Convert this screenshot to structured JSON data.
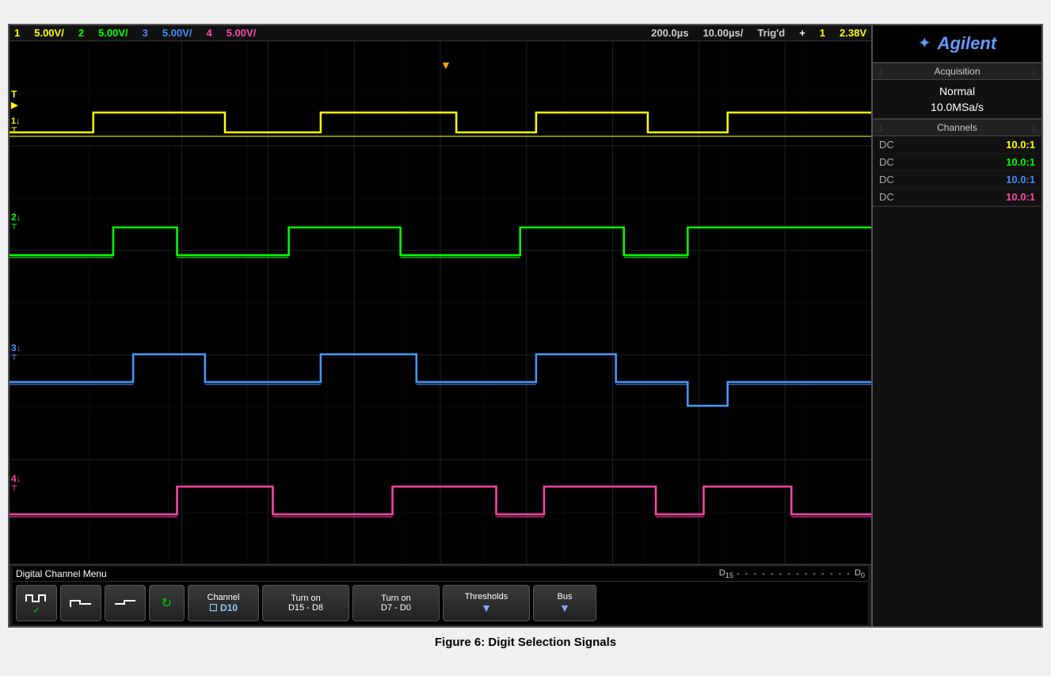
{
  "statusBar": {
    "ch1": "1",
    "ch1_scale": "5.00V/",
    "ch2": "2",
    "ch2_scale": "5.00V/",
    "ch3": "3",
    "ch3_scale": "5.00V/",
    "ch4": "4",
    "ch4_scale": "5.00V/",
    "time_position": "200.0µs",
    "time_scale": "10.00µs/",
    "trig_status": "Trig'd",
    "plus_sign": "+",
    "trig_ch": "1",
    "trig_level": "2.38V"
  },
  "rightPanel": {
    "brand": "Agilent",
    "acquisition_label": "Acquisition",
    "acquisition_mode": "Normal",
    "acquisition_rate": "10.0MSa/s",
    "channels_label": "Channels",
    "channel_rows": [
      {
        "coupling": "DC",
        "value": "10.0:1",
        "color": "yellow"
      },
      {
        "coupling": "DC",
        "value": "10.0:1",
        "color": "green"
      },
      {
        "coupling": "DC",
        "value": "10.0:1",
        "color": "blue"
      },
      {
        "coupling": "DC",
        "value": "10.0:1",
        "color": "pink"
      }
    ]
  },
  "bottomMenu": {
    "menu_label": "Digital Channel Menu",
    "d15_label": "D₁₅",
    "d0_label": "D₀",
    "buttons": [
      {
        "id": "waveform-select-1",
        "line1": "⌐",
        "line2": "✓"
      },
      {
        "id": "waveform-select-2",
        "line1": "⌐_",
        "line2": ""
      },
      {
        "id": "waveform-select-3",
        "line1": "⌐‾",
        "line2": ""
      },
      {
        "id": "refresh-btn",
        "line1": "↻",
        "line2": ""
      },
      {
        "id": "channel-btn",
        "label": "Channel",
        "sub": "D10"
      },
      {
        "id": "turn-on-1",
        "label": "Turn on",
        "sub": "D15 - D8"
      },
      {
        "id": "turn-on-2",
        "label": "Turn on",
        "sub": "D7 - D0"
      },
      {
        "id": "thresholds-btn",
        "label": "Thresholds",
        "sub": "▼"
      },
      {
        "id": "bus-btn",
        "label": "Bus",
        "sub": "▼"
      }
    ],
    "thresholds_label": "Thresholds",
    "bus_label": "Bus"
  },
  "figureCaption": "Figure 6: Digit Selection Signals"
}
